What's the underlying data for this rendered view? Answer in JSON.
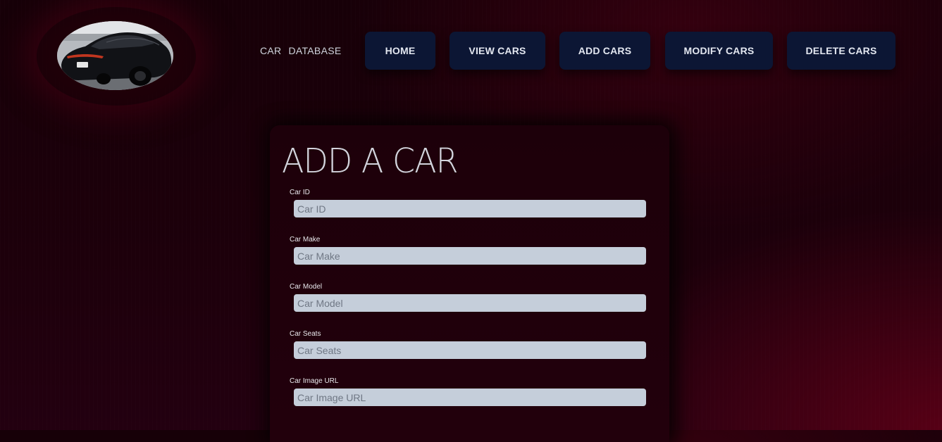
{
  "header": {
    "brand_word1": "CAR",
    "brand_word2": "DATABASE",
    "logo_image": "black sports sedan on road",
    "nav": [
      {
        "label": "HOME"
      },
      {
        "label": "VIEW CARS"
      },
      {
        "label": "ADD CARS"
      },
      {
        "label": "MODIFY CARS"
      },
      {
        "label": "DELETE CARS"
      }
    ]
  },
  "form": {
    "title": "ADD A CAR",
    "fields": [
      {
        "label": "Car ID",
        "placeholder": "Car ID",
        "value": ""
      },
      {
        "label": "Car Make",
        "placeholder": "Car Make",
        "value": ""
      },
      {
        "label": "Car Model",
        "placeholder": "Car Model",
        "value": ""
      },
      {
        "label": "Car Seats",
        "placeholder": "Car Seats",
        "value": ""
      },
      {
        "label": "Car Image URL",
        "placeholder": "Car Image URL",
        "value": ""
      }
    ]
  },
  "colors": {
    "background": "#1d000b",
    "nav_button": "#0c1634",
    "input_background": "#c5ceda"
  }
}
